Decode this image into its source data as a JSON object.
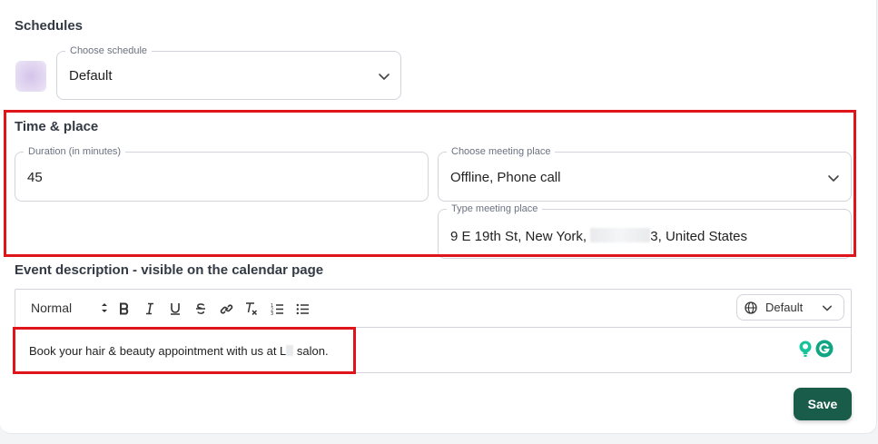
{
  "schedules": {
    "title": "Schedules",
    "choose_schedule_label": "Choose schedule",
    "choose_schedule_value": "Default"
  },
  "time_place": {
    "title": "Time & place",
    "duration_label": "Duration (in minutes)",
    "duration_value": "45",
    "meeting_place_label": "Choose meeting place",
    "meeting_place_value": "Offline, Phone call",
    "type_place_label": "Type meeting place",
    "type_place_value_start": "9 E 19th St, New York, ",
    "type_place_value_end": "3, United States"
  },
  "event_description": {
    "title": "Event description - visible on the calendar page",
    "toolbar": {
      "format": "Normal",
      "language": "Default"
    },
    "text_start": "Book your hair & beauty appointment with us at L",
    "text_end": " salon."
  },
  "actions": {
    "save_label": "Save"
  },
  "colors": {
    "accent": "#1a5c4a",
    "highlight": "#e0141b",
    "swatch": "#dccdf0",
    "grammarly": "#15c39a"
  },
  "icons": {
    "chevron": "chevron-down-icon",
    "globe": "globe-icon",
    "grammarly": "grammarly-icon"
  }
}
